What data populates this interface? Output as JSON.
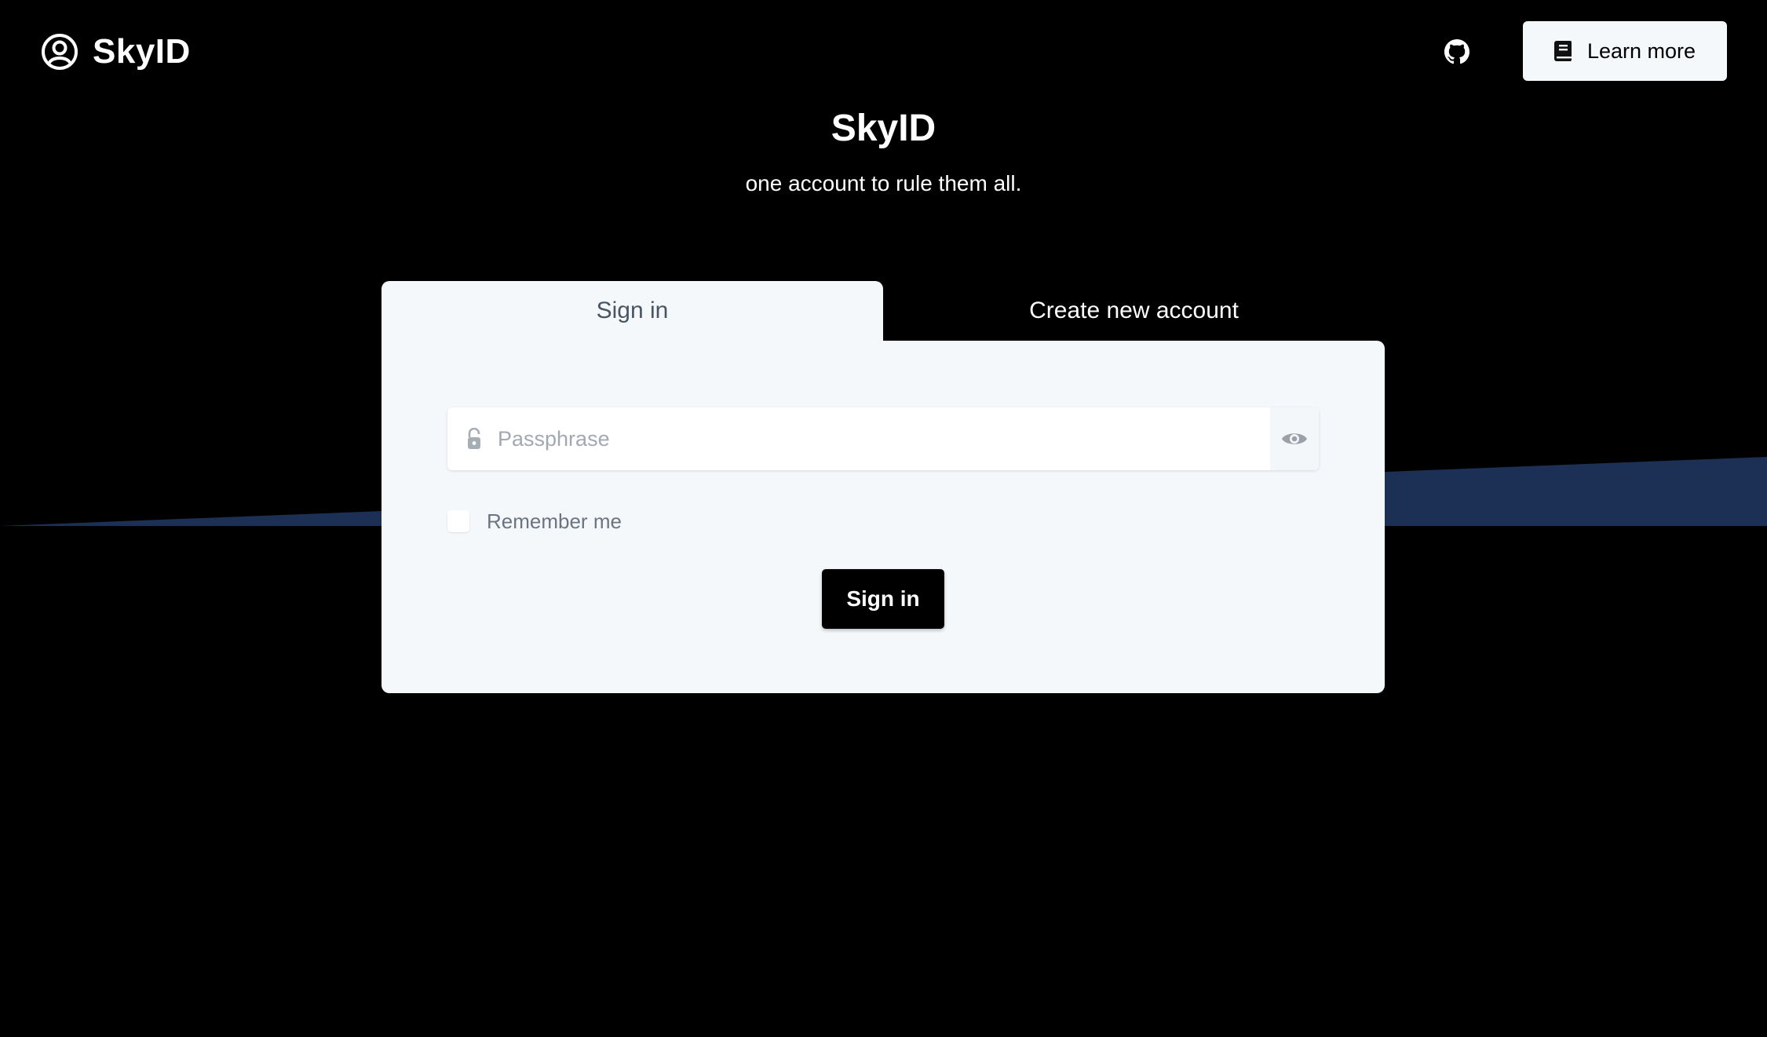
{
  "header": {
    "brand_name": "SkyID",
    "brand_icon": "user-circle-icon",
    "github_icon": "github-icon",
    "learn_more_label": "Learn more",
    "learn_more_icon": "book-icon"
  },
  "hero": {
    "title": "SkyID",
    "subtitle": "one account to rule them all."
  },
  "tabs": [
    {
      "label": "Sign in",
      "active": true
    },
    {
      "label": "Create new account",
      "active": false
    }
  ],
  "form": {
    "passphrase_placeholder": "Passphrase",
    "passphrase_value": "",
    "lock_icon": "unlock-icon",
    "visibility_icon": "eye-icon",
    "remember_label": "Remember me",
    "remember_checked": false,
    "submit_label": "Sign in"
  },
  "colors": {
    "background": "#000000",
    "band": "#1c2f55",
    "card": "#f4f8fb",
    "primary_button": "#000000"
  }
}
